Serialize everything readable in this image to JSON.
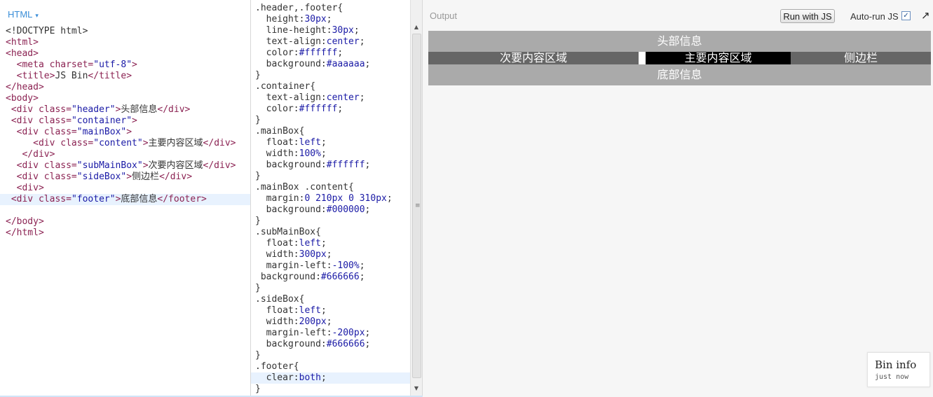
{
  "html_panel": {
    "title": "HTML",
    "caret": "▾",
    "lines": [
      [
        {
          "c": "p",
          "t": "<!DOCTYPE html>"
        }
      ],
      [
        {
          "c": "t",
          "t": "<html>"
        }
      ],
      [
        {
          "c": "t",
          "t": "<head>"
        }
      ],
      [
        {
          "c": "p",
          "t": "  "
        },
        {
          "c": "t",
          "t": "<meta "
        },
        {
          "c": "a",
          "t": "charset="
        },
        {
          "c": "s",
          "t": "\"utf-8\""
        },
        {
          "c": "t",
          "t": ">"
        }
      ],
      [
        {
          "c": "p",
          "t": "  "
        },
        {
          "c": "t",
          "t": "<title>"
        },
        {
          "c": "p",
          "t": "JS Bin"
        },
        {
          "c": "t",
          "t": "</title>"
        }
      ],
      [
        {
          "c": "t",
          "t": "</head>"
        }
      ],
      [
        {
          "c": "t",
          "t": "<body>"
        }
      ],
      [
        {
          "c": "p",
          "t": " "
        },
        {
          "c": "t",
          "t": "<div "
        },
        {
          "c": "a",
          "t": "class="
        },
        {
          "c": "s",
          "t": "\"header\""
        },
        {
          "c": "t",
          "t": ">"
        },
        {
          "c": "p",
          "t": "头部信息"
        },
        {
          "c": "t",
          "t": "</div>"
        }
      ],
      [
        {
          "c": "p",
          "t": " "
        },
        {
          "c": "t",
          "t": "<div "
        },
        {
          "c": "a",
          "t": "class="
        },
        {
          "c": "s",
          "t": "\"container\""
        },
        {
          "c": "t",
          "t": ">"
        }
      ],
      [
        {
          "c": "p",
          "t": "  "
        },
        {
          "c": "t",
          "t": "<div "
        },
        {
          "c": "a",
          "t": "class="
        },
        {
          "c": "s",
          "t": "\"mainBox\""
        },
        {
          "c": "t",
          "t": ">"
        }
      ],
      [
        {
          "c": "p",
          "t": "     "
        },
        {
          "c": "t",
          "t": "<div "
        },
        {
          "c": "a",
          "t": "class="
        },
        {
          "c": "s",
          "t": "\"content\""
        },
        {
          "c": "t",
          "t": ">"
        },
        {
          "c": "p",
          "t": "主要内容区域"
        },
        {
          "c": "t",
          "t": "</div>"
        }
      ],
      [
        {
          "c": "p",
          "t": "   "
        },
        {
          "c": "t",
          "t": "</div>"
        }
      ],
      [
        {
          "c": "p",
          "t": "  "
        },
        {
          "c": "t",
          "t": "<div "
        },
        {
          "c": "a",
          "t": "class="
        },
        {
          "c": "s",
          "t": "\"subMainBox\""
        },
        {
          "c": "t",
          "t": ">"
        },
        {
          "c": "p",
          "t": "次要内容区域"
        },
        {
          "c": "t",
          "t": "</div>"
        }
      ],
      [
        {
          "c": "p",
          "t": "  "
        },
        {
          "c": "t",
          "t": "<div "
        },
        {
          "c": "a",
          "t": "class="
        },
        {
          "c": "s",
          "t": "\"sideBox\""
        },
        {
          "c": "t",
          "t": ">"
        },
        {
          "c": "p",
          "t": "侧边栏"
        },
        {
          "c": "t",
          "t": "</div>"
        }
      ],
      [
        {
          "c": "p",
          "t": "  "
        },
        {
          "c": "t",
          "t": "<div>"
        }
      ],
      [
        {
          "c": "p",
          "t": " "
        },
        {
          "c": "t",
          "t": "<div "
        },
        {
          "c": "a",
          "t": "class="
        },
        {
          "c": "s",
          "t": "\"footer\""
        },
        {
          "c": "t",
          "t": ">"
        },
        {
          "c": "p",
          "t": "底部信息"
        },
        {
          "c": "t",
          "t": "</footer>"
        }
      ],
      [
        {
          "c": "p",
          "t": ""
        }
      ],
      [
        {
          "c": "t",
          "t": "</body>"
        }
      ],
      [
        {
          "c": "t",
          "t": "</html>"
        }
      ]
    ],
    "active_line": 15
  },
  "css_panel": {
    "lines": [
      [
        {
          "c": "p",
          "t": ".header,.footer{"
        }
      ],
      [
        {
          "c": "p",
          "t": "  height:"
        },
        {
          "c": "v",
          "t": "30px"
        },
        {
          "c": "p",
          "t": ";"
        }
      ],
      [
        {
          "c": "p",
          "t": "  line-height:"
        },
        {
          "c": "v",
          "t": "30px"
        },
        {
          "c": "p",
          "t": ";"
        }
      ],
      [
        {
          "c": "p",
          "t": "  text-align:"
        },
        {
          "c": "v",
          "t": "center"
        },
        {
          "c": "p",
          "t": ";"
        }
      ],
      [
        {
          "c": "p",
          "t": "  color:"
        },
        {
          "c": "v",
          "t": "#ffffff"
        },
        {
          "c": "p",
          "t": ";"
        }
      ],
      [
        {
          "c": "p",
          "t": "  background:"
        },
        {
          "c": "v",
          "t": "#aaaaaa"
        },
        {
          "c": "p",
          "t": ";"
        }
      ],
      [
        {
          "c": "p",
          "t": "}"
        }
      ],
      [
        {
          "c": "p",
          "t": ".container{"
        }
      ],
      [
        {
          "c": "p",
          "t": "  text-align:"
        },
        {
          "c": "v",
          "t": "center"
        },
        {
          "c": "p",
          "t": ";"
        }
      ],
      [
        {
          "c": "p",
          "t": "  color:"
        },
        {
          "c": "v",
          "t": "#ffffff"
        },
        {
          "c": "p",
          "t": ";"
        }
      ],
      [
        {
          "c": "p",
          "t": "}"
        }
      ],
      [
        {
          "c": "p",
          "t": ".mainBox{"
        }
      ],
      [
        {
          "c": "p",
          "t": "  float:"
        },
        {
          "c": "v",
          "t": "left"
        },
        {
          "c": "p",
          "t": ";"
        }
      ],
      [
        {
          "c": "p",
          "t": "  width:"
        },
        {
          "c": "v",
          "t": "100%"
        },
        {
          "c": "p",
          "t": ";"
        }
      ],
      [
        {
          "c": "p",
          "t": "  background:"
        },
        {
          "c": "v",
          "t": "#ffffff"
        },
        {
          "c": "p",
          "t": ";"
        }
      ],
      [
        {
          "c": "p",
          "t": "}"
        }
      ],
      [
        {
          "c": "p",
          "t": ".mainBox .content{"
        }
      ],
      [
        {
          "c": "p",
          "t": "  margin:"
        },
        {
          "c": "v",
          "t": "0 210px 0 310px"
        },
        {
          "c": "p",
          "t": ";"
        }
      ],
      [
        {
          "c": "p",
          "t": "  background:"
        },
        {
          "c": "v",
          "t": "#000000"
        },
        {
          "c": "p",
          "t": ";"
        }
      ],
      [
        {
          "c": "p",
          "t": "}"
        }
      ],
      [
        {
          "c": "p",
          "t": ".subMainBox{"
        }
      ],
      [
        {
          "c": "p",
          "t": "  float:"
        },
        {
          "c": "v",
          "t": "left"
        },
        {
          "c": "p",
          "t": ";"
        }
      ],
      [
        {
          "c": "p",
          "t": "  width:"
        },
        {
          "c": "v",
          "t": "300px"
        },
        {
          "c": "p",
          "t": ";"
        }
      ],
      [
        {
          "c": "p",
          "t": "  margin-left:"
        },
        {
          "c": "v",
          "t": "-100%"
        },
        {
          "c": "p",
          "t": ";"
        }
      ],
      [
        {
          "c": "p",
          "t": " background:"
        },
        {
          "c": "v",
          "t": "#666666"
        },
        {
          "c": "p",
          "t": ";"
        }
      ],
      [
        {
          "c": "p",
          "t": "}"
        }
      ],
      [
        {
          "c": "p",
          "t": ".sideBox{"
        }
      ],
      [
        {
          "c": "p",
          "t": "  float:"
        },
        {
          "c": "v",
          "t": "left"
        },
        {
          "c": "p",
          "t": ";"
        }
      ],
      [
        {
          "c": "p",
          "t": "  width:"
        },
        {
          "c": "v",
          "t": "200px"
        },
        {
          "c": "p",
          "t": ";"
        }
      ],
      [
        {
          "c": "p",
          "t": "  margin-left:"
        },
        {
          "c": "v",
          "t": "-200px"
        },
        {
          "c": "p",
          "t": ";"
        }
      ],
      [
        {
          "c": "p",
          "t": "  background:"
        },
        {
          "c": "v",
          "t": "#666666"
        },
        {
          "c": "p",
          "t": ";"
        }
      ],
      [
        {
          "c": "p",
          "t": "}"
        }
      ],
      [
        {
          "c": "p",
          "t": ".footer{"
        }
      ],
      [
        {
          "c": "p",
          "t": "  clear:"
        },
        {
          "c": "v",
          "t": "both"
        },
        {
          "c": "p",
          "t": ";"
        }
      ],
      [
        {
          "c": "p",
          "t": "}"
        }
      ]
    ],
    "active_line": 33,
    "scroll_up": "▲",
    "scroll_down": "▼",
    "grip": "≡"
  },
  "output": {
    "title": "Output",
    "run_button": "Run with JS",
    "autorun_label": "Auto-run JS",
    "autorun_checked": "✓",
    "popout": "↗",
    "render": {
      "header": "头部信息",
      "sub": "次要内容区域",
      "content": "主要内容区域",
      "side": "侧边栏",
      "footer": "底部信息"
    },
    "bin_info": {
      "title": "Bin info",
      "subtitle": "just now"
    }
  },
  "colors": {
    "panel_title": "#3a8ed8",
    "tag": "#8b2252",
    "string": "#1a1aa6",
    "header_bg": "#aaaaaa",
    "side_bg": "#666666",
    "content_bg": "#000000"
  }
}
